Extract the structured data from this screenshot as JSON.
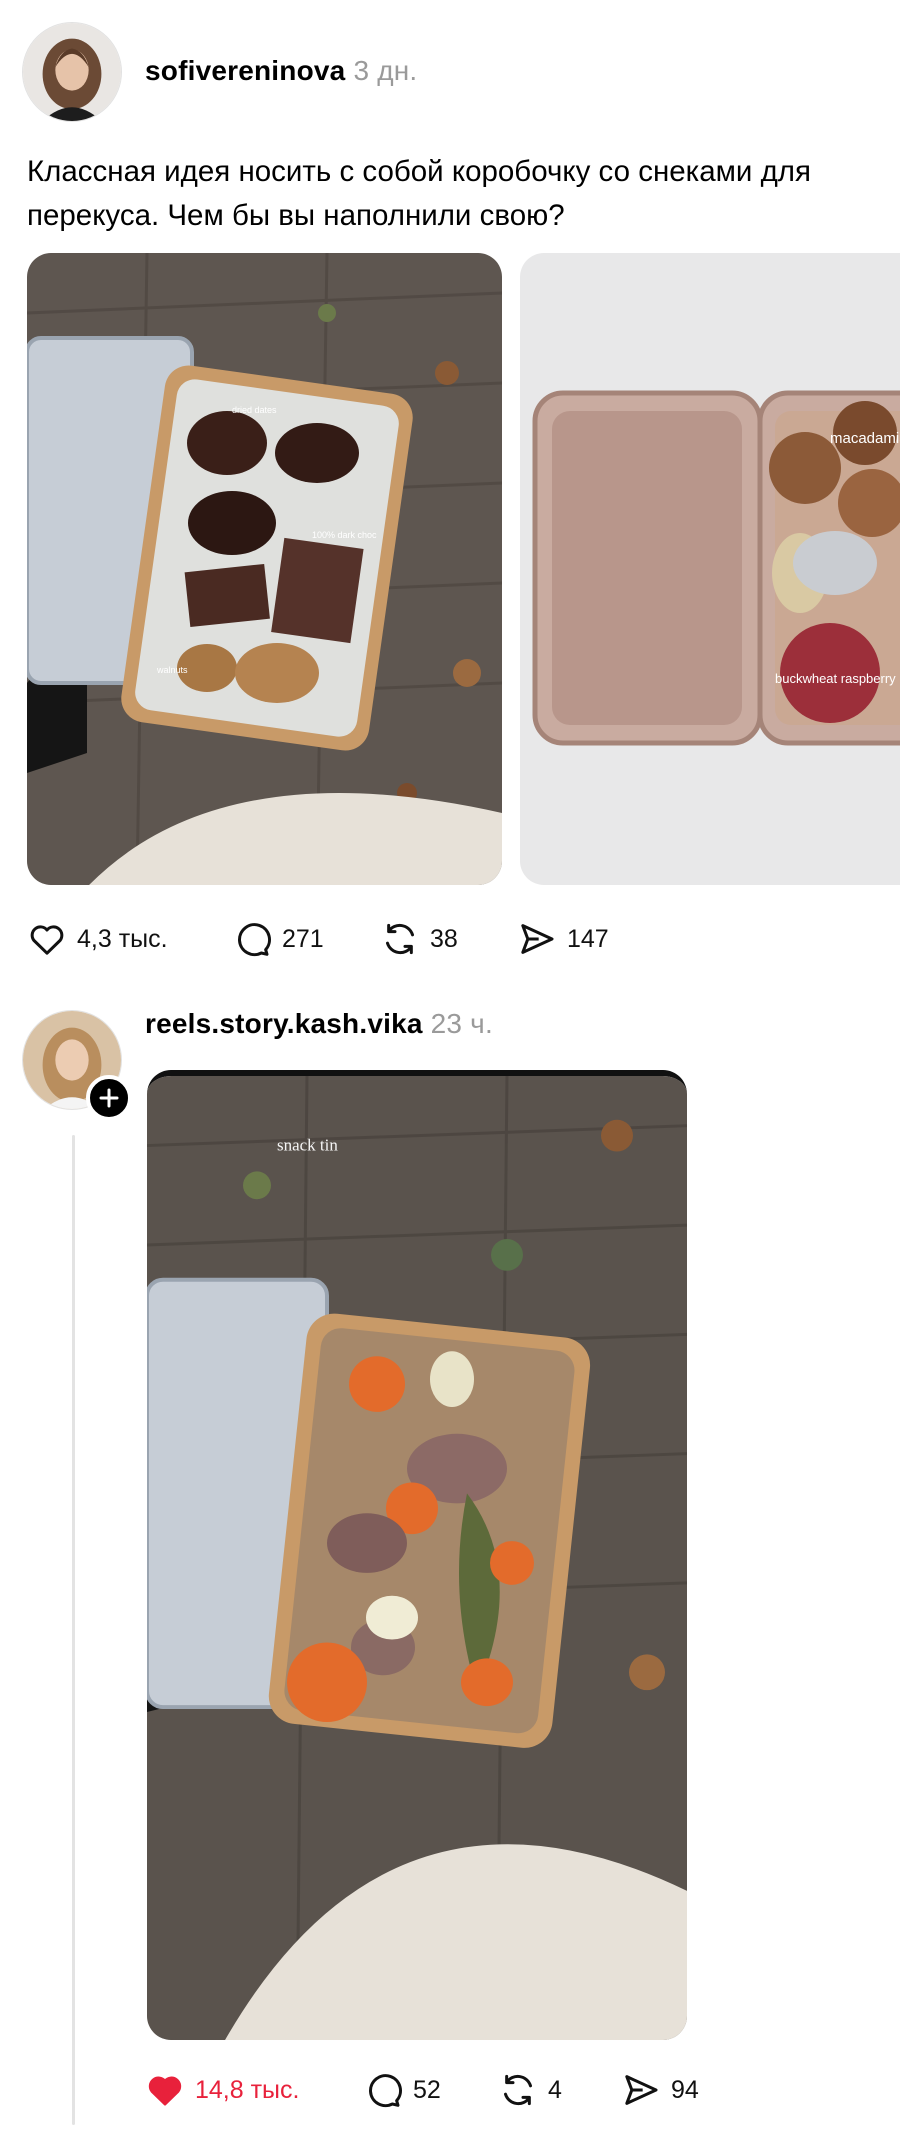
{
  "posts": [
    {
      "username": "sofivereninova",
      "time": "3 дн.",
      "text": "Классная идея носить с собой коробочку со снеками для перекуса. Чем бы вы наполнили свою?",
      "photo1_labels": {
        "dates": "dried dates",
        "choc": "100% dark choc",
        "walnuts": "walnuts"
      },
      "photo2_labels": {
        "macadamia": "macadamia in shell",
        "balls": "buckwheat raspberry balls"
      },
      "stats": {
        "likes": "4,3 тыс.",
        "comments": "271",
        "reposts": "38",
        "shares": "147"
      },
      "liked": false
    },
    {
      "username": "reels.story.kash.vika",
      "time": "23 ч.",
      "photo_label": "snack tin",
      "stats": {
        "likes": "14,8 тыс.",
        "comments": "52",
        "reposts": "4",
        "shares": "94"
      },
      "liked": true
    }
  ],
  "colors": {
    "like_active": "#e8213b",
    "muted": "#9a9a9a"
  },
  "icons": [
    "heart-icon",
    "comment-icon",
    "repost-icon",
    "share-icon",
    "plus-icon"
  ]
}
